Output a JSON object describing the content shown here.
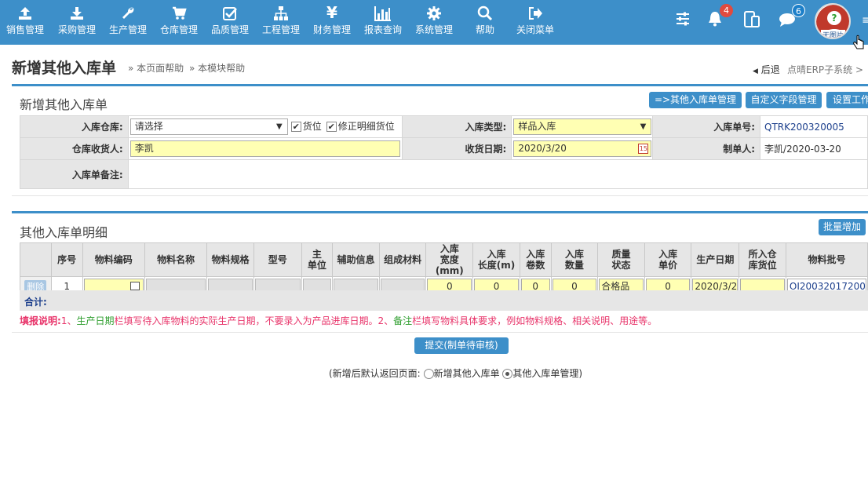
{
  "nav": {
    "items": [
      {
        "label": "销售管理",
        "icon": "upload-icon"
      },
      {
        "label": "采购管理",
        "icon": "download-icon"
      },
      {
        "label": "生产管理",
        "icon": "wrench-icon"
      },
      {
        "label": "仓库管理",
        "icon": "cart-icon"
      },
      {
        "label": "品质管理",
        "icon": "checkbox-icon"
      },
      {
        "label": "工程管理",
        "icon": "sitemap-icon"
      },
      {
        "label": "财务管理",
        "icon": "yen-icon"
      },
      {
        "label": "报表查询",
        "icon": "bar-chart-icon"
      },
      {
        "label": "系统管理",
        "icon": "gear-icon"
      },
      {
        "label": "帮助",
        "icon": "search-icon"
      },
      {
        "label": "关闭菜单",
        "icon": "sign-out-icon"
      }
    ],
    "bell_badge": "4",
    "chat_badge": "6",
    "avatar_text": "无图片"
  },
  "header": {
    "title": "新增其他入库单",
    "help_page": "» 本页面帮助",
    "help_module": "» 本模块帮助",
    "back": "后退",
    "crumb": "点晴ERP子系统 >"
  },
  "form_panel": {
    "title": "新增其他入库单",
    "buttons": [
      "=>其他入库单管理",
      "自定义字段管理",
      "设置工作"
    ],
    "warehouse_label": "入库仓库:",
    "warehouse_value": "请选择",
    "location_label": "货位",
    "fix_location_label": "修正明细货位",
    "type_label": "入库类型:",
    "type_value": "样品入库",
    "no_label": "入库单号:",
    "no_value": "QTRK200320005",
    "receiver_label": "仓库收货人:",
    "receiver_value": "李凯",
    "date_label": "收货日期:",
    "date_value": "2020/3/20",
    "maker_label": "制单人:",
    "maker_value": "李凯/2020-03-20",
    "remark_label": "入库单备注:"
  },
  "detail_panel": {
    "title": "其他入库单明细",
    "batch_add": "批量增加",
    "columns": [
      "序号",
      "物料编码",
      "物料名称",
      "物料规格",
      "型号",
      "主\n单位",
      "辅助信息",
      "组成材料",
      "入库\n宽度(mm)",
      "入库\n长度(m)",
      "入库\n卷数",
      "入库\n数量",
      "质量\n状态",
      "入库\n单价",
      "生产日期",
      "所入仓\n库货位",
      "物料批号"
    ],
    "row": {
      "delete": "删除",
      "index": "1",
      "width": "0",
      "length": "0",
      "rolls": "0",
      "qty": "0",
      "quality": "合格品",
      "price": "0",
      "prod_date": "2020/3/2",
      "batch_no": "OI20032017200"
    },
    "total_label": "合计:",
    "note_prefix": "填报说明:",
    "note_1a": "1、",
    "note_1b": "生产日期",
    "note_1c": "栏填写待入库物料的实际生产日期，不要录入为产品进库日期。2、",
    "note_2b": "备注",
    "note_2c": "栏填写物料具体要求，例如物料规格、相关说明、用途等。"
  },
  "submit": {
    "label": "提交(制单待审核)",
    "return_prefix": "(新增后默认返回页面:",
    "option_new": "新增其他入库单",
    "option_manage": "其他入库单管理)"
  },
  "colors": {
    "nav_bg": "#3d8fc9",
    "input_yellow": "#ffffb3",
    "note_pink": "#e8346a",
    "note_green": "#2e9e2e"
  }
}
